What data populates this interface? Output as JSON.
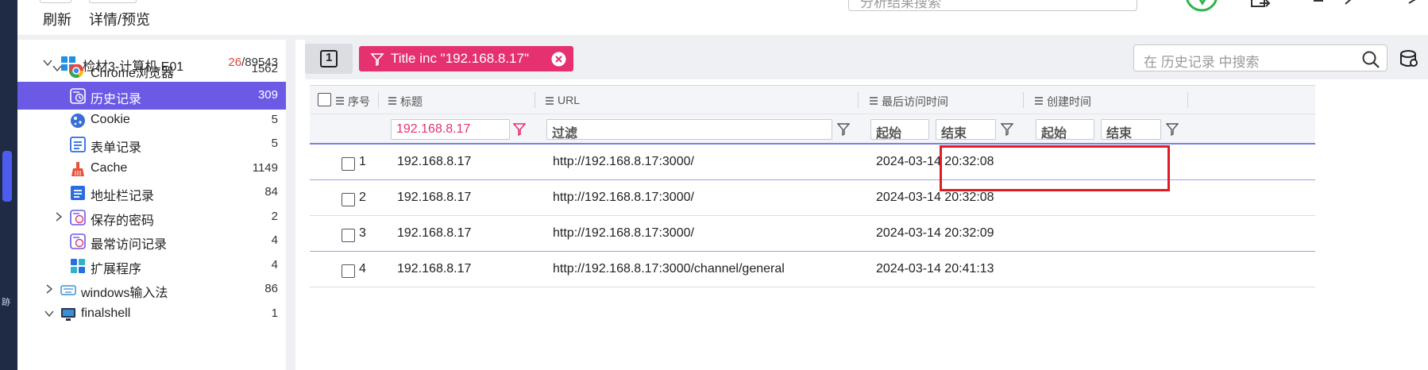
{
  "toolbar": {
    "refresh_label": "刷新",
    "details_label": "详情/预览",
    "search_placeholder": "分析结果搜索"
  },
  "left_strip": {
    "tiny_text": "跡"
  },
  "tree": {
    "root": {
      "label": "检材3-计算机.E01",
      "count_red": "26",
      "count_rest": "/89543"
    },
    "chrome": {
      "label": "Chrome浏览器",
      "count": "1562"
    },
    "items": [
      {
        "label": "历史记录",
        "count": "309"
      },
      {
        "label": "Cookie",
        "count": "5"
      },
      {
        "label": "表单记录",
        "count": "5"
      },
      {
        "label": "Cache",
        "count": "1149"
      },
      {
        "label": "地址栏记录",
        "count": "84"
      },
      {
        "label": "保存的密码",
        "count": "2"
      },
      {
        "label": "最常访问记录",
        "count": "4"
      },
      {
        "label": "扩展程序",
        "count": "4"
      }
    ],
    "windows_ime": {
      "label": "windows输入法",
      "count": "86"
    },
    "finalshell": {
      "label": "finalshell",
      "count": "1"
    }
  },
  "main": {
    "page_button": "1",
    "filter_chip": "Title inc \"192.168.8.17\"",
    "search_placeholder": "在 历史记录 中搜索",
    "columns": {
      "seq": "序号",
      "title": "标题",
      "url": "URL",
      "last_visit": "最后访问时间",
      "created": "创建时间"
    },
    "filters": {
      "title_value": "192.168.8.17",
      "url_placeholder": "过滤",
      "start": "起始",
      "end": "结束"
    },
    "rows": [
      {
        "seq": "1",
        "title": "192.168.8.17",
        "url": "http://192.168.8.17:3000/",
        "last_visit": "2024-03-14 20:32:08"
      },
      {
        "seq": "2",
        "title": "192.168.8.17",
        "url": "http://192.168.8.17:3000/",
        "last_visit": "2024-03-14 20:32:08"
      },
      {
        "seq": "3",
        "title": "192.168.8.17",
        "url": "http://192.168.8.17:3000/",
        "last_visit": "2024-03-14 20:32:09"
      },
      {
        "seq": "4",
        "title": "192.168.8.17",
        "url": "http://192.168.8.17:3000/channel/general",
        "last_visit": "2024-03-14 20:41:13"
      }
    ]
  },
  "colors": {
    "accent": "#6a5ae6",
    "filter_chip": "#e5316f",
    "highlight": "#e01b24",
    "count_red": "#e0443a"
  }
}
